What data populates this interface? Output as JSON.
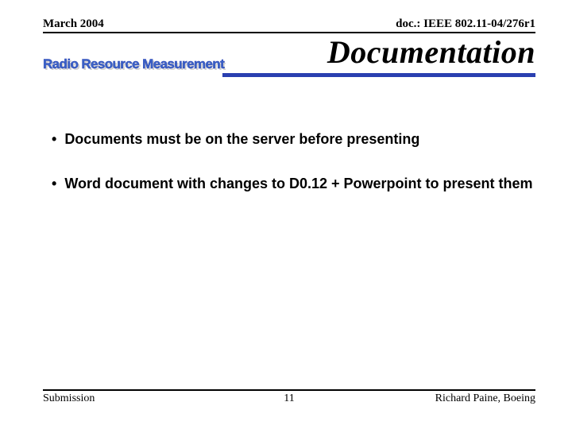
{
  "header": {
    "left": "March 2004",
    "right": "doc.: IEEE 802.11-04/276r1"
  },
  "title": "Documentation",
  "logo_text": "Radio Resource Measurement",
  "bullets": [
    "Documents must be on the server before presenting",
    "Word document with changes to D0.12 + Powerpoint to present them"
  ],
  "footer": {
    "left": "Submission",
    "center": "11",
    "right": "Richard Paine, Boeing"
  },
  "colors": {
    "accent": "#2a3fb0",
    "logo_fill": "#3a63c8",
    "logo_shadow": "#d0d0d0"
  }
}
